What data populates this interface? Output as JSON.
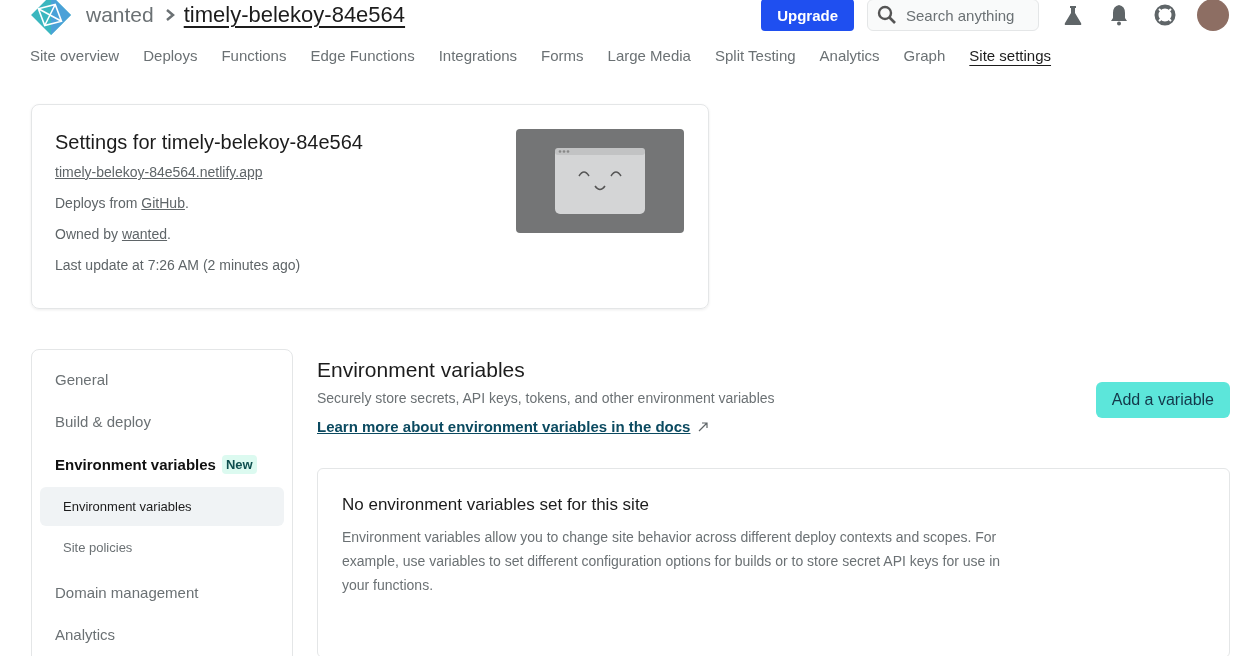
{
  "header": {
    "team": "wanted",
    "site": "timely-belekoy-84e564",
    "upgrade": "Upgrade",
    "search": {
      "placeholder": "Search anything"
    }
  },
  "tabs": [
    {
      "label": "Site overview",
      "selected": false
    },
    {
      "label": "Deploys",
      "selected": false
    },
    {
      "label": "Functions",
      "selected": false
    },
    {
      "label": "Edge Functions",
      "selected": false
    },
    {
      "label": "Integrations",
      "selected": false
    },
    {
      "label": "Forms",
      "selected": false
    },
    {
      "label": "Large Media",
      "selected": false
    },
    {
      "label": "Split Testing",
      "selected": false
    },
    {
      "label": "Analytics",
      "selected": false
    },
    {
      "label": "Graph",
      "selected": false
    },
    {
      "label": "Site settings",
      "selected": true
    }
  ],
  "site_card": {
    "title": "Settings for timely-belekoy-84e564",
    "url": "timely-belekoy-84e564.netlify.app",
    "lines": [
      {
        "text": "Deploys from",
        "link": "GitHub",
        "suffix": "."
      },
      {
        "text": "Owned by",
        "link": "wanted",
        "suffix": "."
      },
      {
        "text": "Last update at 7:26 AM (2 minutes ago)"
      }
    ]
  },
  "sidebar": {
    "items": [
      {
        "label": "General",
        "active": false
      },
      {
        "label": "Build & deploy",
        "active": false
      },
      {
        "label": "Environment variables",
        "active": true,
        "badge": "New",
        "children": [
          {
            "label": "Environment variables",
            "selected": true
          },
          {
            "label": "Site policies",
            "selected": false
          }
        ]
      },
      {
        "label": "Domain management",
        "active": false
      },
      {
        "label": "Analytics",
        "active": false
      }
    ]
  },
  "main": {
    "title": "Environment variables",
    "subtitle": "Securely store secrets, API keys, tokens, and other environment variables",
    "doc_link": "Learn more about environment variables in the docs",
    "add_button": "Add a variable",
    "empty": {
      "title": "No environment variables set for this site",
      "text": "Environment variables allow you to change site behavior across different deploy contexts and scopes. For example, use variables to set different configuration options for builds or to store secret API keys for use in your functions."
    }
  }
}
